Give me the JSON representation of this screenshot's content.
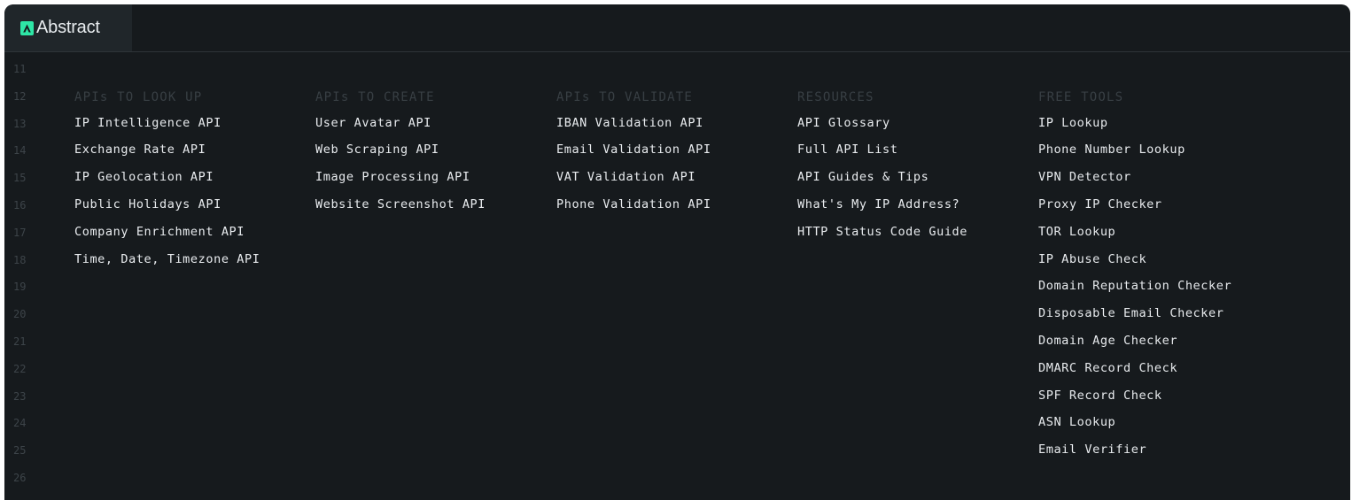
{
  "brand": {
    "name": "Abstract",
    "accent": "#2ee6a6"
  },
  "line_numbers": [
    "11",
    "12",
    "13",
    "14",
    "15",
    "16",
    "17",
    "18",
    "19",
    "20",
    "21",
    "22",
    "23",
    "24",
    "25",
    "26"
  ],
  "columns": [
    {
      "heading": "APIs TO LOOK UP",
      "links": [
        "IP Intelligence API",
        "Exchange Rate API",
        "IP Geolocation API",
        "Public Holidays API",
        "Company Enrichment API",
        "Time, Date, Timezone API"
      ]
    },
    {
      "heading": "APIs TO CREATE",
      "links": [
        "User Avatar API",
        "Web Scraping API",
        "Image Processing API",
        "Website Screenshot API"
      ]
    },
    {
      "heading": "APIs TO VALIDATE",
      "links": [
        "IBAN Validation API",
        "Email Validation API",
        "VAT Validation API",
        "Phone Validation API"
      ]
    },
    {
      "heading": "RESOURCES",
      "links": [
        "API Glossary",
        "Full API List",
        "API Guides & Tips",
        "What's My IP Address?",
        "HTTP Status Code Guide"
      ]
    },
    {
      "heading": "FREE TOOLS",
      "links": [
        "IP Lookup",
        "Phone Number Lookup",
        "VPN Detector",
        "Proxy IP Checker",
        "TOR Lookup",
        "IP Abuse Check",
        "Domain Reputation Checker",
        "Disposable Email Checker",
        "Domain Age Checker",
        "DMARC Record Check",
        "SPF Record Check",
        "ASN Lookup",
        "Email Verifier"
      ]
    }
  ]
}
